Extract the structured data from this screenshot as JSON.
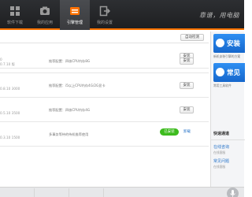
{
  "nav": {
    "items": [
      {
        "label": "软件下载",
        "icon": "grid-icon"
      },
      {
        "label": "我的应用",
        "icon": "camera-icon"
      },
      {
        "label": "引擎管理",
        "icon": "engine-box-icon"
      },
      {
        "label": "我的设置",
        "icon": "exit-icon"
      }
    ],
    "active_index": 2,
    "slogan": "靠谱，用电脑"
  },
  "toolbar": {
    "check_label": "自动检测"
  },
  "rows": [
    {
      "size": "0",
      "requirement": "",
      "action": "安装"
    },
    {
      "size": "0.7.10 版",
      "requirement": "推荐配置：四核CPU内存8G",
      "action": "安装"
    },
    {
      "size": "0.8.10 3000",
      "requirement": "推荐配置：i5以上CPU内存4G/2G显卡",
      "action": "安装"
    },
    {
      "size": "0.5.10 3500",
      "requirement": "推荐配置：四核CPU内存4G",
      "action": "安装"
    },
    {
      "size": "0.3.10 1500",
      "requirement": "多事务等待的待机推荐使用",
      "badge": "已安装",
      "link": "卸载"
    }
  ],
  "sidebar": {
    "promos": [
      {
        "title": "安装",
        "caption": "新机安装引擎的方案"
      },
      {
        "title": "常见",
        "caption": "常用工具软件"
      }
    ],
    "quick_title": "快速通道",
    "quick_links": [
      {
        "title": "在线咨询",
        "desc": "在线客服"
      },
      {
        "title": "常见问题",
        "desc": "在线客服"
      }
    ]
  },
  "colors": {
    "accent": "#ff7200",
    "installed": "#3dbb1e",
    "promo": "#1e7be0",
    "link": "#2a75c9"
  }
}
